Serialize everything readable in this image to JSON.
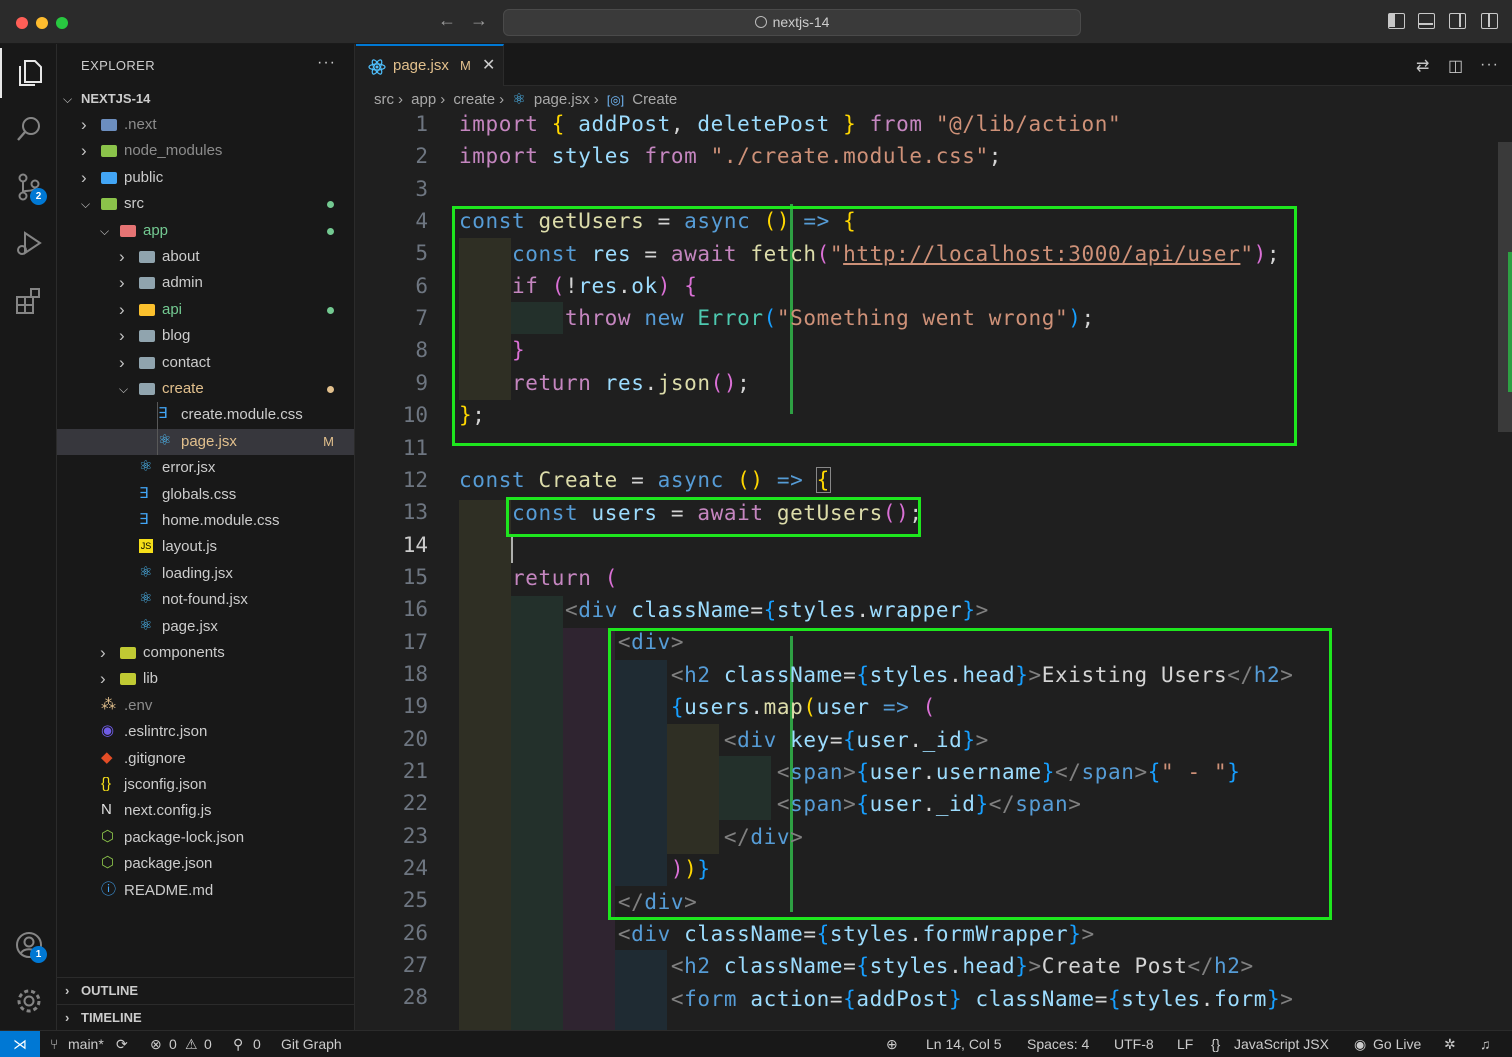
{
  "window": {
    "title": "nextjs-14"
  },
  "sidebar": {
    "title": "EXPLORER",
    "more": "···",
    "root": "NEXTJS-14",
    "items": [
      {
        "label": ".next",
        "kind": "folder",
        "icon": "folder-icon"
      },
      {
        "label": "node_modules",
        "kind": "folder",
        "icon": "folder-icon"
      },
      {
        "label": "public",
        "kind": "folder",
        "icon": "folder-icon"
      },
      {
        "label": "src",
        "kind": "folder-open",
        "icon": "folder-icon"
      },
      {
        "label": "app",
        "kind": "folder-open",
        "icon": "folder-icon"
      },
      {
        "label": "about",
        "kind": "folder",
        "icon": "folder-icon"
      },
      {
        "label": "admin",
        "kind": "folder",
        "icon": "folder-icon"
      },
      {
        "label": "api",
        "kind": "folder",
        "icon": "folder-icon"
      },
      {
        "label": "blog",
        "kind": "folder",
        "icon": "folder-icon"
      },
      {
        "label": "contact",
        "kind": "folder",
        "icon": "folder-icon"
      },
      {
        "label": "create",
        "kind": "folder-open",
        "icon": "folder-icon"
      },
      {
        "label": "create.module.css",
        "kind": "css",
        "icon": "css-file-icon"
      },
      {
        "label": "page.jsx",
        "kind": "react",
        "icon": "react-file-icon",
        "status": "M"
      },
      {
        "label": "error.jsx",
        "kind": "react",
        "icon": "react-file-icon"
      },
      {
        "label": "globals.css",
        "kind": "css",
        "icon": "css-file-icon"
      },
      {
        "label": "home.module.css",
        "kind": "css",
        "icon": "css-file-icon"
      },
      {
        "label": "layout.js",
        "kind": "js",
        "icon": "js-file-icon"
      },
      {
        "label": "loading.jsx",
        "kind": "react",
        "icon": "react-file-icon"
      },
      {
        "label": "not-found.jsx",
        "kind": "react",
        "icon": "react-file-icon"
      },
      {
        "label": "page.jsx",
        "kind": "react",
        "icon": "react-file-icon"
      },
      {
        "label": "components",
        "kind": "folder",
        "icon": "folder-icon"
      },
      {
        "label": "lib",
        "kind": "folder",
        "icon": "folder-icon"
      },
      {
        "label": ".env",
        "kind": "env",
        "icon": "env-file-icon"
      },
      {
        "label": ".eslintrc.json",
        "kind": "eslint",
        "icon": "eslint-file-icon"
      },
      {
        "label": ".gitignore",
        "kind": "git",
        "icon": "git-file-icon"
      },
      {
        "label": "jsconfig.json",
        "kind": "json",
        "icon": "json-file-icon"
      },
      {
        "label": "next.config.js",
        "kind": "next",
        "icon": "next-file-icon"
      },
      {
        "label": "package-lock.json",
        "kind": "npm",
        "icon": "npm-file-icon"
      },
      {
        "label": "package.json",
        "kind": "npm",
        "icon": "npm-file-icon"
      },
      {
        "label": "README.md",
        "kind": "info",
        "icon": "info-file-icon"
      }
    ],
    "outline": "OUTLINE",
    "timeline": "TIMELINE"
  },
  "activity": {
    "source_control_badge": "2",
    "accounts_badge": "1"
  },
  "tab": {
    "name": "page.jsx",
    "modified": "M",
    "close": "✕"
  },
  "breadcrumb": [
    "src",
    "app",
    "create",
    "page.jsx",
    "Create"
  ],
  "editor": {
    "current_line": 14,
    "line_numbers": [
      "1",
      "2",
      "3",
      "4",
      "5",
      "6",
      "7",
      "8",
      "9",
      "10",
      "11",
      "12",
      "13",
      "14",
      "15",
      "16",
      "17",
      "18",
      "19",
      "20",
      "21",
      "22",
      "23",
      "24",
      "25",
      "26",
      "27",
      "28"
    ]
  },
  "statusbar": {
    "branch": "main*",
    "errors": "0",
    "warnings": "0",
    "ports": "0",
    "git_graph": "Git Graph",
    "position": "Ln 14, Col 5",
    "spaces": "Spaces: 4",
    "encoding": "UTF-8",
    "eol": "LF",
    "language": "JavaScript JSX",
    "go_live": "Go Live"
  },
  "colors": {
    "accent": "#0078d4",
    "highlight_box": "#1ee61e",
    "modified": "#e2c08d"
  }
}
